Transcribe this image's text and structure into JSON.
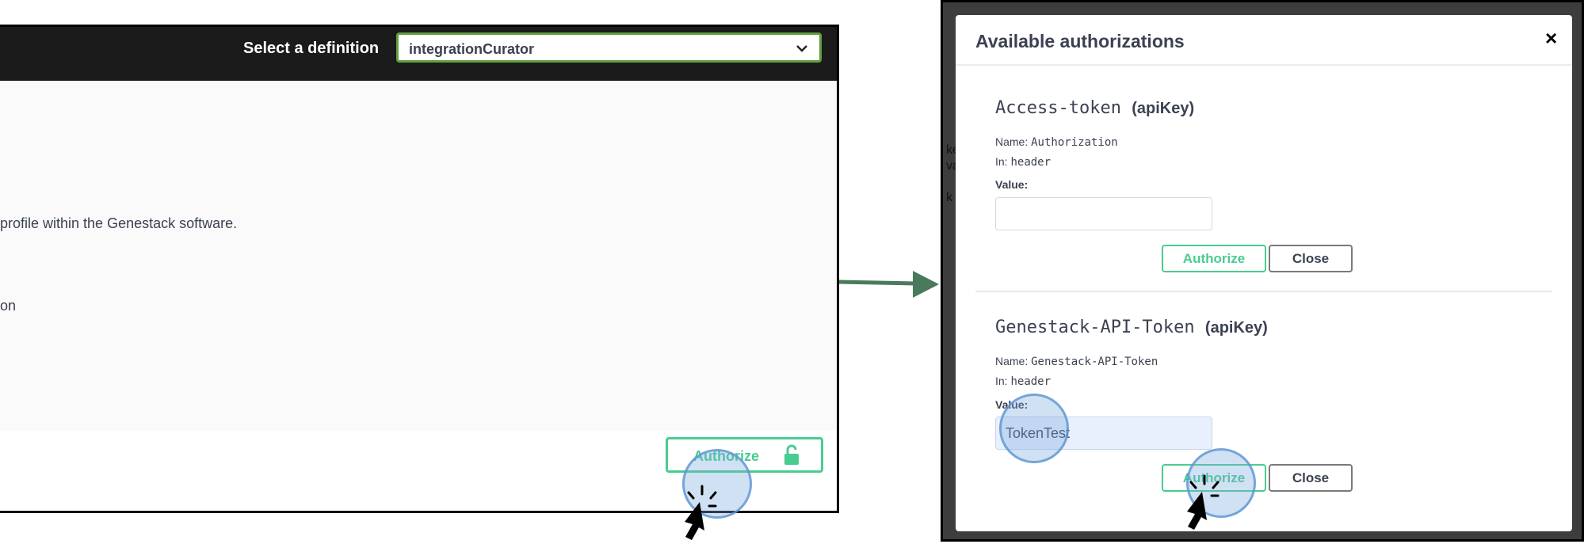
{
  "left": {
    "select_label": "Select a definition",
    "definition_value": "integrationCurator",
    "body_text_1": "profile within the Genestack software.",
    "body_text_2": "on",
    "authorize_label": "Authorize"
  },
  "modal": {
    "title": "Available authorizations",
    "close_symbol": "×",
    "auths": [
      {
        "name": "Access-token",
        "type": "(apiKey)",
        "name_label": "Name:",
        "name_value": "Authorization",
        "in_label": "In:",
        "in_value": "header",
        "value_label": "Value:",
        "value": "",
        "authorize_label": "Authorize",
        "close_label": "Close"
      },
      {
        "name": "Genestack-API-Token",
        "type": "(apiKey)",
        "name_label": "Name:",
        "name_value": "Genestack-API-Token",
        "in_label": "In:",
        "in_value": "header",
        "value_label": "Value:",
        "value": "TokenTest",
        "authorize_label": "Authorize",
        "close_label": "Close"
      }
    ]
  },
  "colors": {
    "accent_green": "#49cc90",
    "select_border": "#62a03f",
    "topbar": "#1b1b1b",
    "arrow": "#4a7a5c",
    "text": "#3b4151"
  },
  "icons": [
    "chevron-down-icon",
    "unlock-icon",
    "arrow-right-icon",
    "cursor-click-icon"
  ]
}
